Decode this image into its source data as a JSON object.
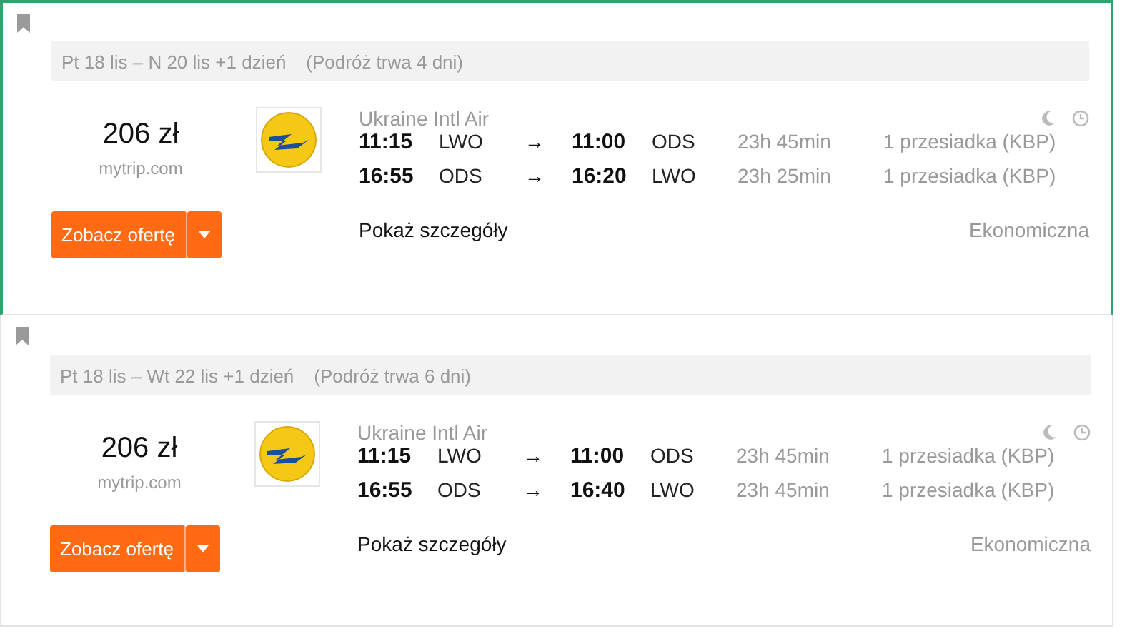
{
  "offers": [
    {
      "selected": true,
      "dates": "Pt 18 lis – N 20 lis +1 dzień",
      "trip_length": "(Podróż trwa 4 dni)",
      "price": "206 zł",
      "site": "mytrip.com",
      "button": "Zobacz ofertę",
      "airline": "Ukraine Intl Air",
      "legs": [
        {
          "depart": "11:15",
          "from": "LWO",
          "arrow": "→",
          "arrive": "11:00",
          "to": "ODS",
          "duration": "23h 45min",
          "stops": "1 przesiadka (KBP)"
        },
        {
          "depart": "16:55",
          "from": "ODS",
          "arrow": "→",
          "arrive": "16:20",
          "to": "LWO",
          "duration": "23h 25min",
          "stops": "1 przesiadka (KBP)"
        }
      ],
      "details_link": "Pokaż szczegóły",
      "cabin": "Ekonomiczna"
    },
    {
      "selected": false,
      "dates": "Pt 18 lis – Wt 22 lis +1 dzień",
      "trip_length": "(Podróż trwa 6 dni)",
      "price": "206 zł",
      "site": "mytrip.com",
      "button": "Zobacz ofertę",
      "airline": "Ukraine Intl Air",
      "legs": [
        {
          "depart": "11:15",
          "from": "LWO",
          "arrow": "→",
          "arrive": "11:00",
          "to": "ODS",
          "duration": "23h 45min",
          "stops": "1 przesiadka (KBP)"
        },
        {
          "depart": "16:55",
          "from": "ODS",
          "arrow": "→",
          "arrive": "16:40",
          "to": "LWO",
          "duration": "23h 45min",
          "stops": "1 przesiadka (KBP)"
        }
      ],
      "details_link": "Pokaż szczegóły",
      "cabin": "Ekonomiczna"
    }
  ]
}
